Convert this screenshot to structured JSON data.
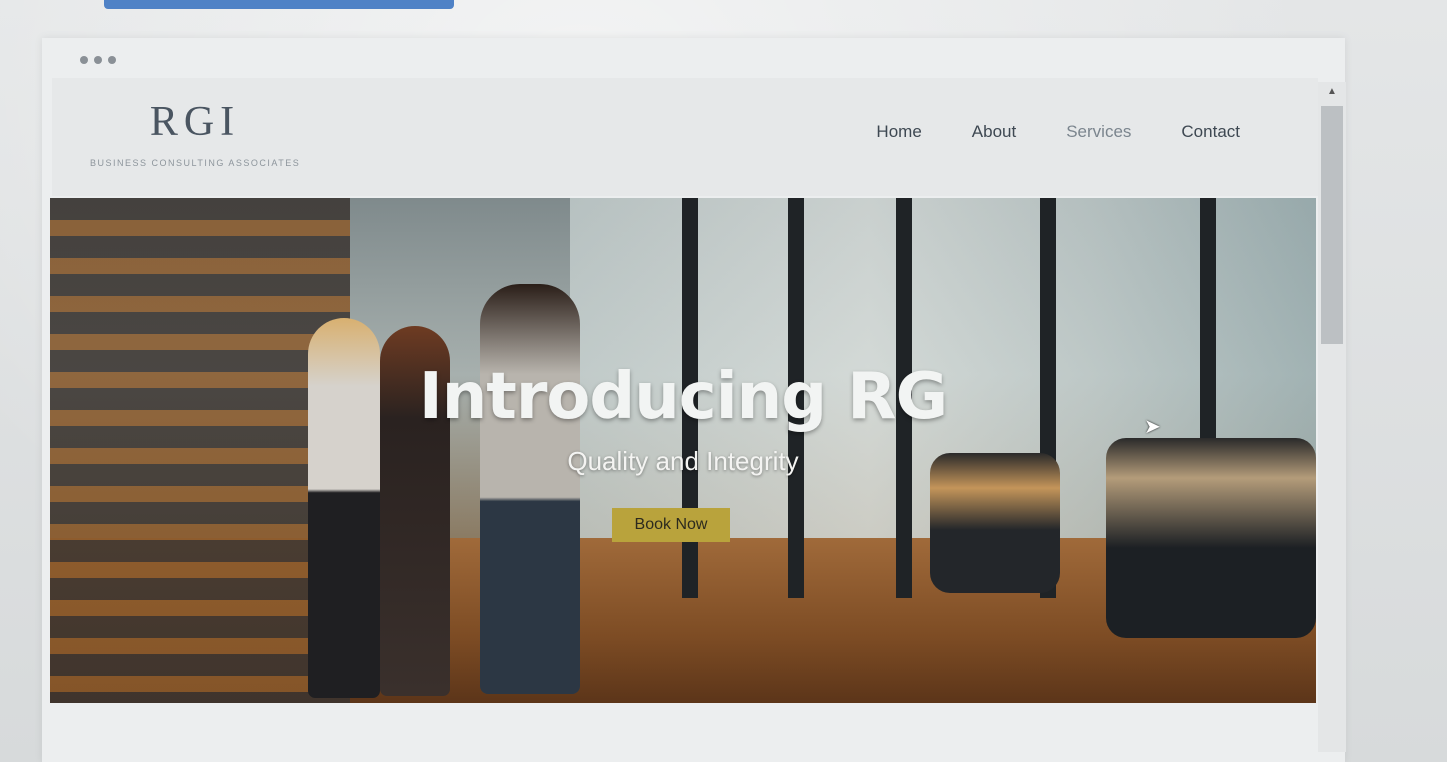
{
  "site": {
    "logo_text": "RGI",
    "logo_tagline": "BUSINESS CONSULTING ASSOCIATES"
  },
  "nav": {
    "items": [
      {
        "label": "Home"
      },
      {
        "label": "About"
      },
      {
        "label": "Services"
      },
      {
        "label": "Contact"
      }
    ]
  },
  "hero": {
    "title": "Introducing RG",
    "subtitle": "Quality and Integrity",
    "cta_label": "Book Now"
  },
  "colors": {
    "accent": "#b9a33c",
    "nav_text": "#3e4852"
  }
}
